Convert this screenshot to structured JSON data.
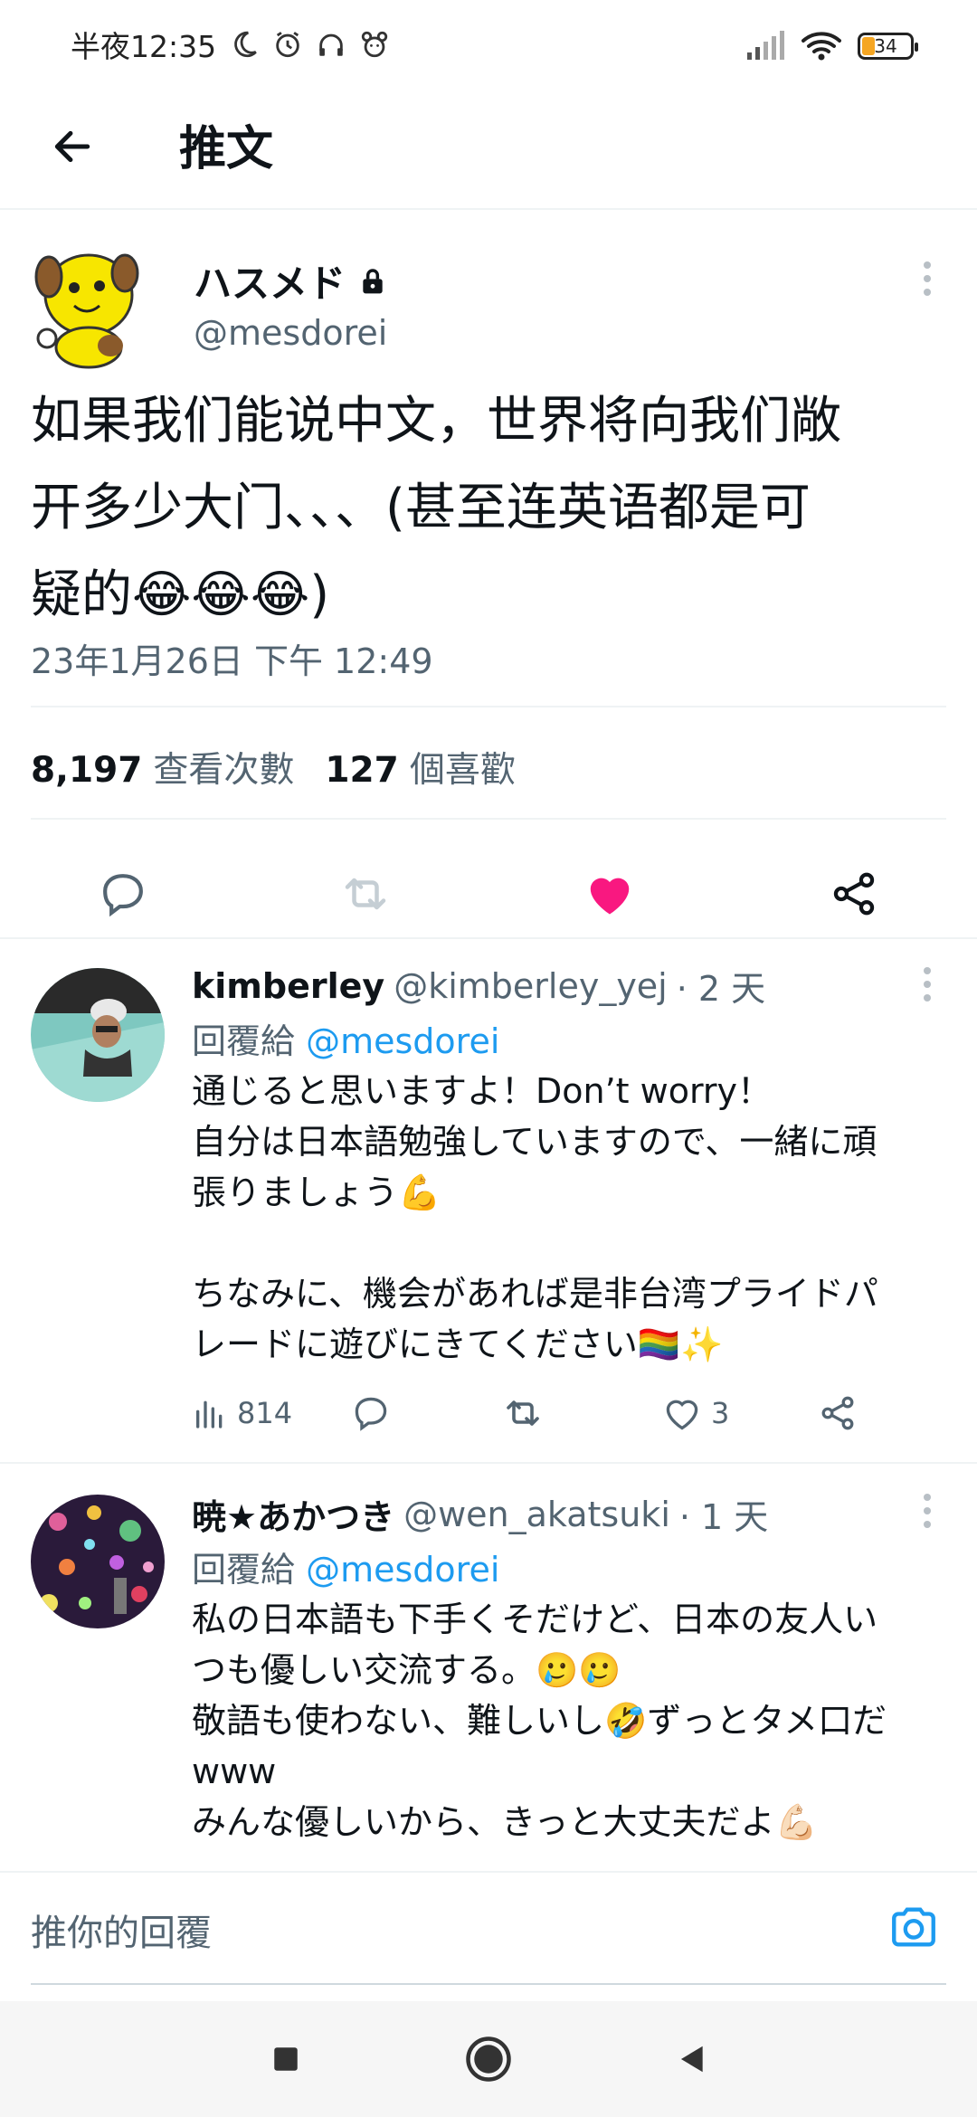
{
  "status_bar": {
    "time": "半夜12:35",
    "battery_level": "34",
    "icons": [
      "moon-icon",
      "alarm-icon",
      "headphones-icon",
      "bear-icon",
      "signal-icon",
      "wifi-icon",
      "battery-icon"
    ]
  },
  "header": {
    "title": "推文"
  },
  "tweet": {
    "display_name": "ハスメド",
    "handle": "@mesdorei",
    "text_line1": "如果我们能说中文，世界将向我们敞",
    "text_line2": "开多少大门、、、(甚至连英语都是可",
    "text_line3": "疑的😂😂😂)",
    "timestamp": "23年1月26日 下午 12:49",
    "views_count": "8,197",
    "views_label": "查看次數",
    "likes_count": "127",
    "likes_label": "個喜歡",
    "liked": true,
    "like_color": "#f91880"
  },
  "replies": [
    {
      "display_name": "kimberley",
      "handle": "@kimberley_yej",
      "time": "· 2 天",
      "reply_to_label": "回覆給",
      "reply_to_handle": "@mesdorei",
      "text": "通じると思いますよ！Don’t worry！\n自分は日本語勉強していますので、一緒に頑\n張りましょう💪\n\nちなみに、機会があれば是非台湾プライドパ\nレードに遊びにきてください🏳️‍🌈✨",
      "views": "814",
      "likes": "3"
    },
    {
      "display_name": "暁★あかつき",
      "handle": "@wen_akatsuki",
      "time": "· 1 天",
      "reply_to_label": "回覆給",
      "reply_to_handle": "@mesdorei",
      "text": "私の日本語も下手くそだけど、日本の友人い\nつも優しい交流する。🥲🥲\n敬語も使わない、難しいし🤣ずっとタメ口だ\nwww\nみんな優しいから、きっと大丈夫だよ💪🏻"
    }
  ],
  "compose": {
    "placeholder": "推你的回覆"
  },
  "colors": {
    "accent": "#1d9bf0",
    "like": "#f91880",
    "secondary_text": "#536471"
  }
}
